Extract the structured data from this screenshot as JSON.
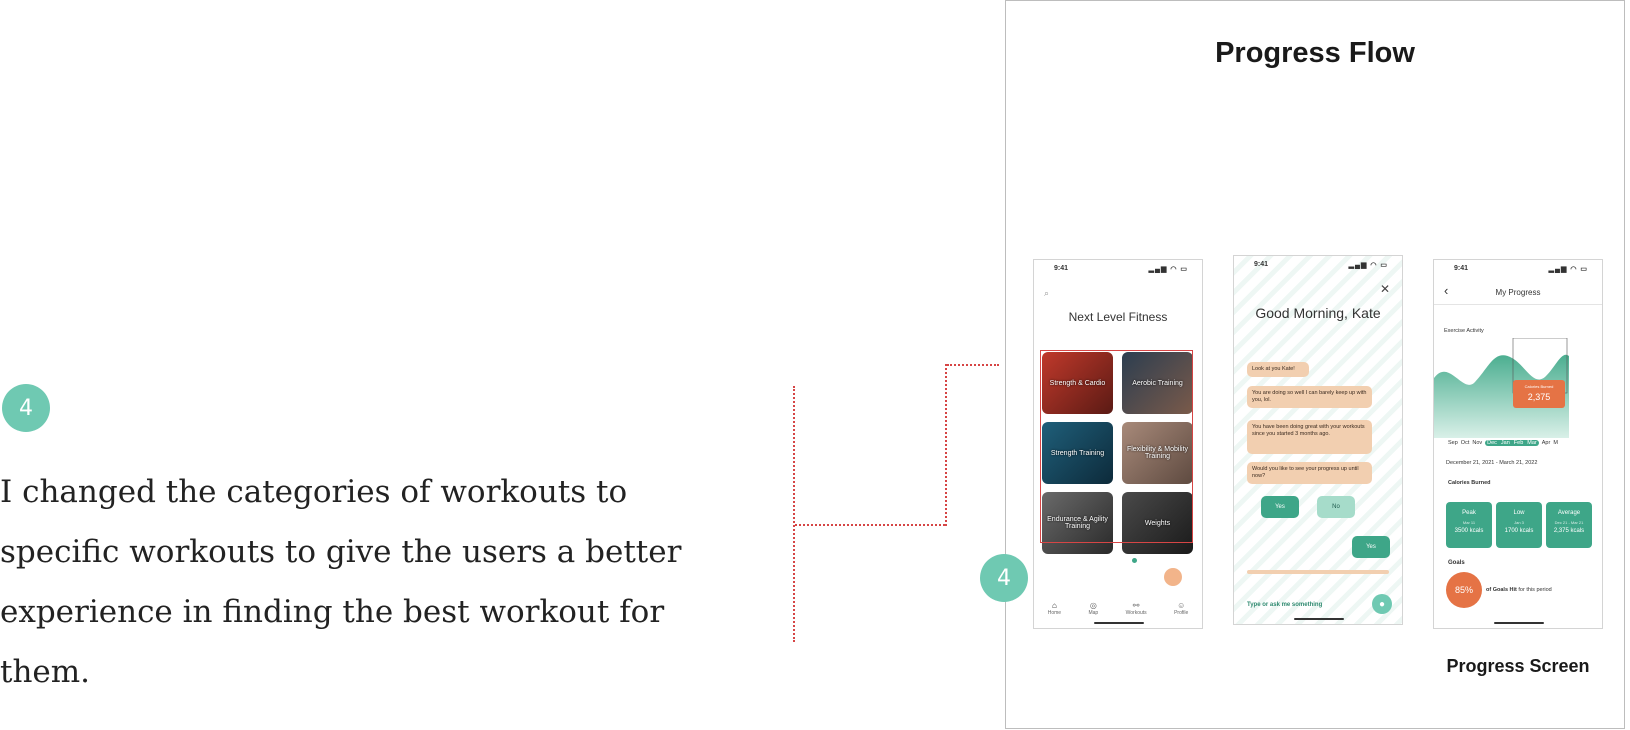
{
  "step_number": "4",
  "description": "I changed the categories of workouts to specific workouts to give the users a better experience in finding the best workout for them.",
  "frame": {
    "title": "Progress Flow",
    "caption": "Progress Screen"
  },
  "status_bar": {
    "time": "9:41",
    "icons": "▂▄▆ ◠ ▭"
  },
  "home_screen": {
    "app_title": "Next Level Fitness",
    "tiles": [
      "Strength & Cardio",
      "Aerobic Training",
      "Strength Training",
      "Flexibility & Mobility Training",
      "Endurance & Agility Training",
      "Weights"
    ],
    "tabs": [
      "Home",
      "Map",
      "Workouts",
      "Profile"
    ]
  },
  "chat_screen": {
    "greeting": "Good Morning, Kate",
    "messages": [
      "Look at you Kate!",
      "You are doing so well I can barely keep up with you, lol.",
      "You have been doing great with your workouts since you started 3 months ago.",
      "Would you like to see your progress up until now?"
    ],
    "yes_label": "Yes",
    "no_label": "No",
    "reply_label": "Yes",
    "input_placeholder": "Type or ask me something"
  },
  "progress_screen": {
    "title": "My Progress",
    "section_label": "Exercise Activity",
    "tooltip_label": "Calories Burned",
    "tooltip_value": "2,375",
    "months": [
      "Sep",
      "Oct",
      "Nov",
      "Dec",
      "Jan",
      "Feb",
      "Mar",
      "Apr",
      "M"
    ],
    "date_range": "December 21, 2021 - March 21, 2022",
    "calories_label": "Calories Burned",
    "stats": [
      {
        "label": "Peak",
        "sub": "Mar 11",
        "value": "3500 kcals"
      },
      {
        "label": "Low",
        "sub": "Jan 3",
        "value": "1700 kcals"
      },
      {
        "label": "Average",
        "sub": "Dec 21 - Mar 21",
        "value": "2,375 kcals"
      }
    ],
    "goals_label": "Goals",
    "goals_percent": "85%",
    "goals_text": "of Goals Hit",
    "goals_suffix": "for this period"
  },
  "colors": {
    "accent": "#6fc9b2",
    "brand_green": "#3ea688",
    "chat_bubble": "#f2cfb0",
    "goal_orange": "#e57345",
    "highlight_red": "#d64545"
  }
}
